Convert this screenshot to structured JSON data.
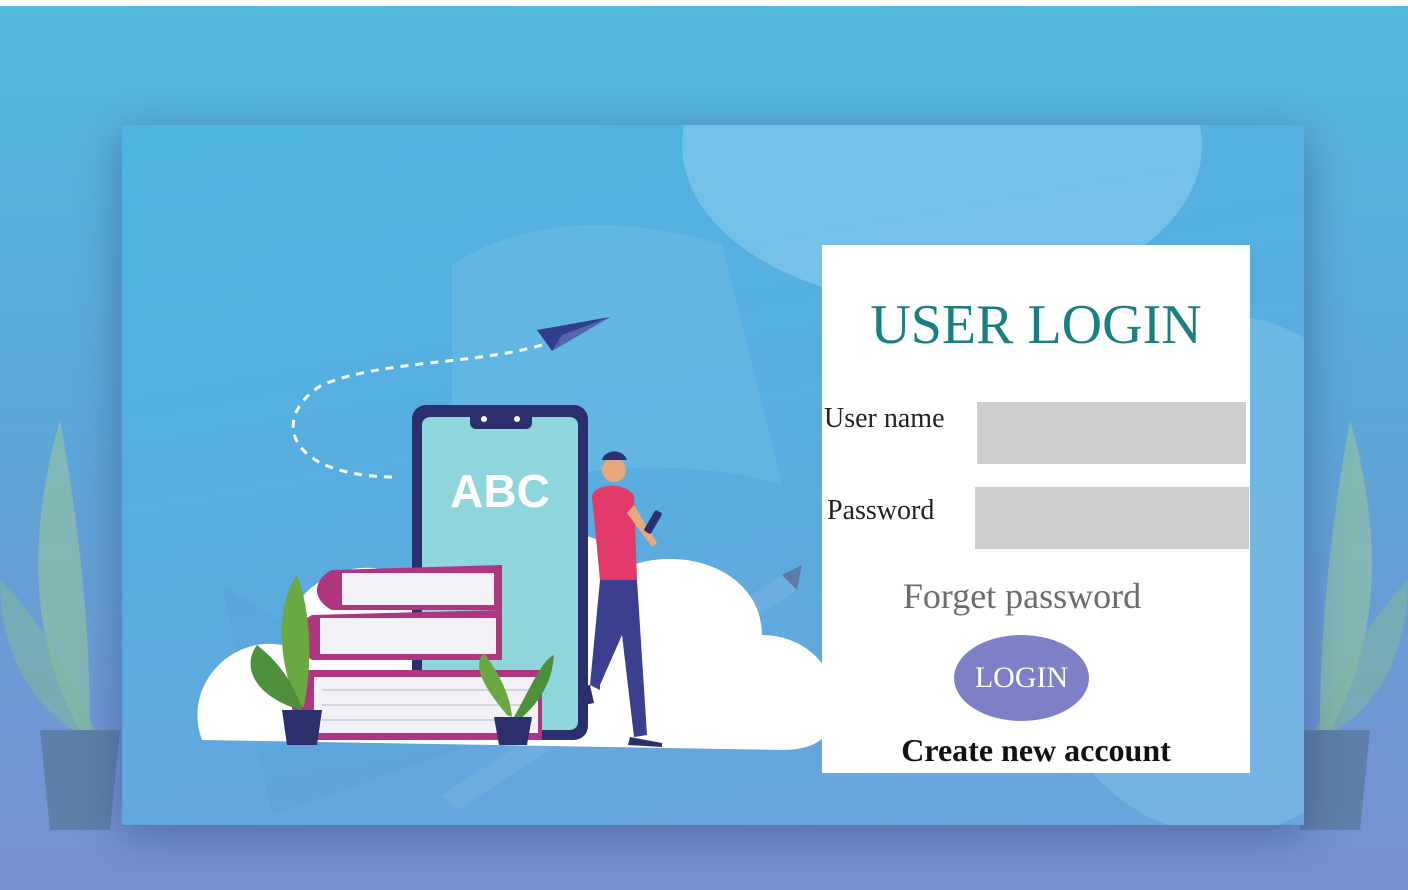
{
  "login": {
    "title": "USER LOGIN",
    "username_label": "User name",
    "username_value": "",
    "password_label": "Password",
    "password_value": "",
    "forgot_label": "Forget password",
    "login_button": "LOGIN",
    "create_account": "Create new account"
  },
  "illustration": {
    "phone_text": "ABC"
  },
  "colors": {
    "title": "#1a7f80",
    "button": "#7d80c6",
    "input": "#cccccc"
  }
}
